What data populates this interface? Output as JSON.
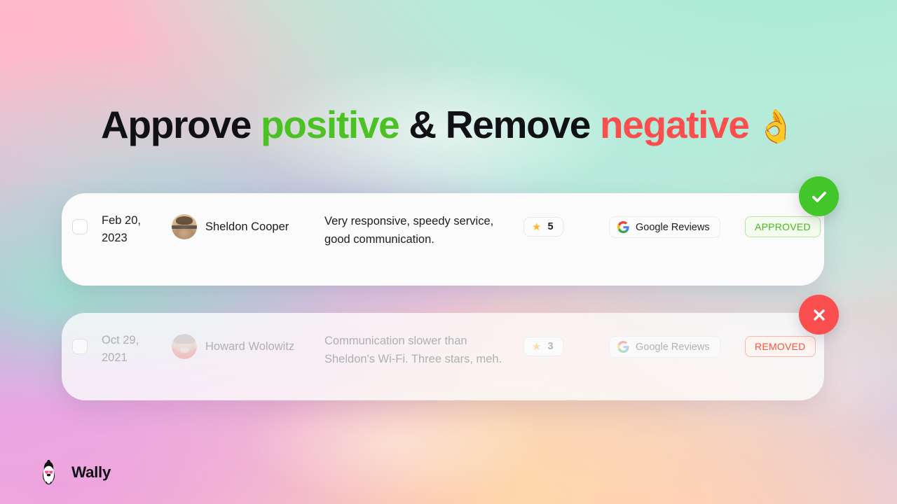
{
  "headline": {
    "word1": "Approve ",
    "positive": "positive",
    "word2": " & Remove ",
    "negative": "negative",
    "emoji": "👌"
  },
  "reviews": [
    {
      "checkbox_checked": false,
      "date": "Feb 20, 2023",
      "author": "Sheldon Cooper",
      "avatar_alt": "sheldon-cooper-avatar",
      "text": "Very responsive, speedy service, good communication.",
      "rating": "5",
      "star_icon": "star-icon",
      "source": "Google Reviews",
      "source_icon": "google-icon",
      "status": "APPROVED",
      "badge_icon": "check-icon"
    },
    {
      "checkbox_checked": false,
      "date": "Oct 29, 2021",
      "author": "Howard Wolowitz",
      "avatar_alt": "howard-wolowitz-avatar",
      "text": "Communication slower than Sheldon's Wi-Fi. Three stars, meh.",
      "rating": "3",
      "star_icon": "star-icon",
      "source": "Google Reviews",
      "source_icon": "google-icon",
      "status": "REMOVED",
      "badge_icon": "close-icon"
    }
  ],
  "brand": {
    "name": "Wally",
    "logo_icon": "penguin-logo-icon"
  },
  "colors": {
    "positive_green": "#4cc123",
    "negative_red": "#fb4e4e",
    "approved_badge": "#43c62a",
    "removed_badge": "#fb4f4f",
    "star_yellow": "#fcb81e",
    "text_primary": "#1d1d1f",
    "card_background": "#fbfbfb"
  }
}
